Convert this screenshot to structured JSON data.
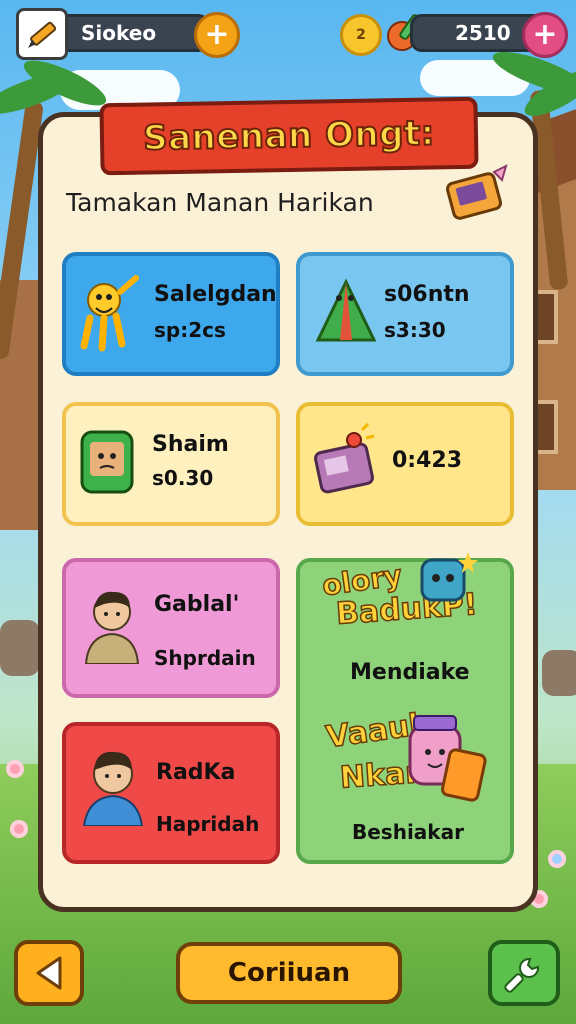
{
  "topbar": {
    "left_label": "Siokeo",
    "right_value": "2510",
    "coin_label": "2"
  },
  "panel": {
    "banner_title": "Sanenan Ongt:",
    "subtitle": "Tamakan Manan Harikan"
  },
  "cards": [
    {
      "title": "Salelgdan",
      "value": "sp:2cs"
    },
    {
      "title": "s06ntn",
      "value": "s3:30"
    },
    {
      "title": "Shaim",
      "value": "s0.30"
    },
    {
      "title": "0:423",
      "value": ""
    },
    {
      "title": "Gablal'",
      "value": "Shprdain"
    },
    {
      "title": "RadKa",
      "value": "Hapridah"
    }
  ],
  "promo": {
    "top_line1": "olory",
    "top_line2": "BadukP!",
    "top_label": "Mendiake",
    "bottom_line1": "Vaaul",
    "bottom_line2": "Nkar",
    "bottom_label": "Beshiakar"
  },
  "bottom": {
    "continue_label": "Coriiuan"
  },
  "colors": {
    "accent_orange": "#ffba2e",
    "banner_red": "#e5402a",
    "card_blue": "#3ea8ec",
    "card_pink": "#ef9ad6",
    "card_red": "#ef4a48",
    "card_green": "#8ed37a"
  }
}
